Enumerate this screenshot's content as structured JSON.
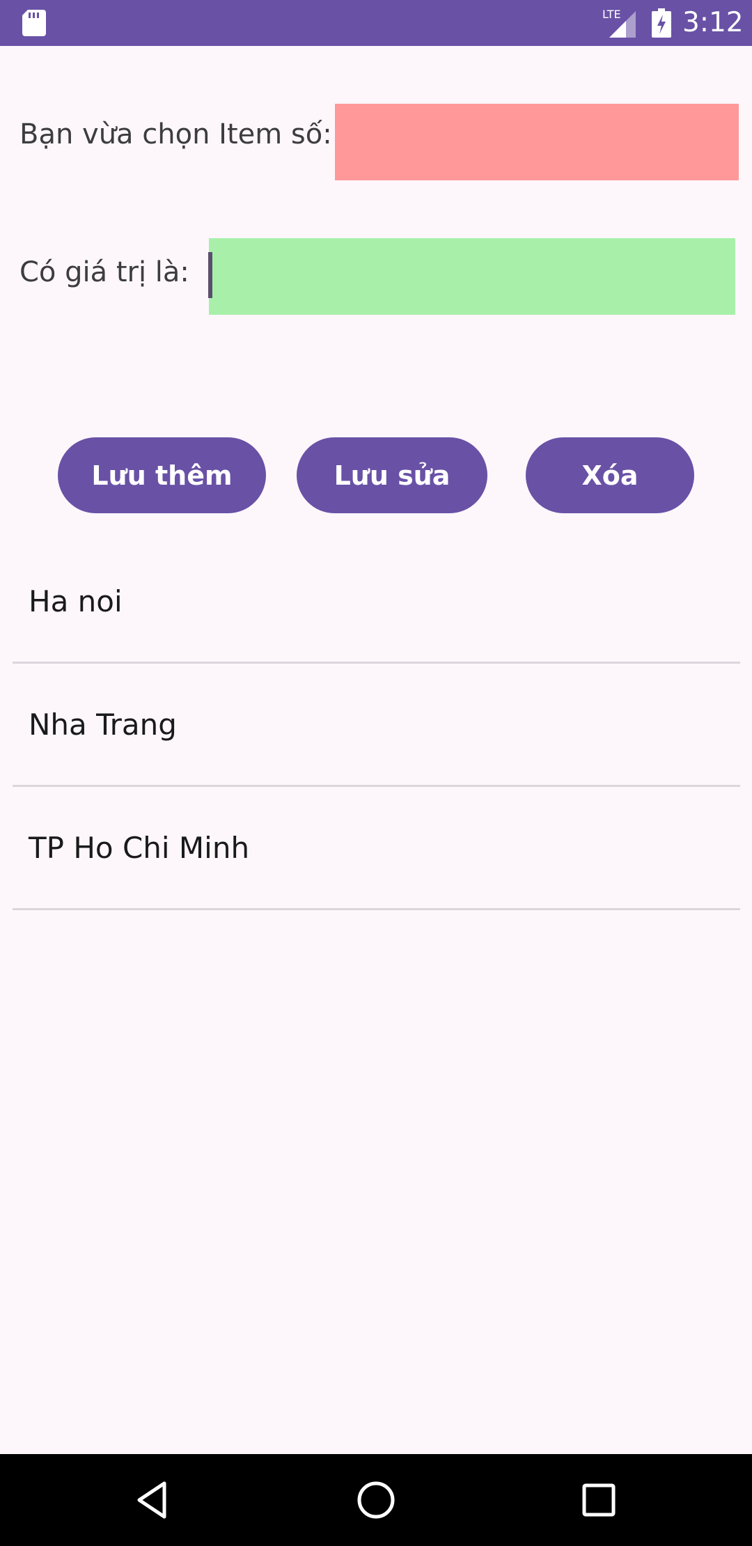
{
  "status_bar": {
    "network_label": "LTE",
    "time": "3:12",
    "color": "#6951a6"
  },
  "form": {
    "item_label": "Bạn vừa chọn Item số:",
    "item_value": "",
    "item_field_color": "#ff9999",
    "value_label": "Có giá trị là:",
    "value_value": "",
    "value_field_color": "#a8f0aa"
  },
  "buttons": {
    "add_label": "Lưu thêm",
    "edit_label": "Lưu sửa",
    "delete_label": "Xóa",
    "color": "#6951a6"
  },
  "list": {
    "items": [
      "Ha noi",
      "Nha Trang",
      "TP Ho Chi Minh"
    ]
  },
  "nav_bar": {
    "icons": [
      "back-icon",
      "home-icon",
      "recents-icon"
    ]
  }
}
